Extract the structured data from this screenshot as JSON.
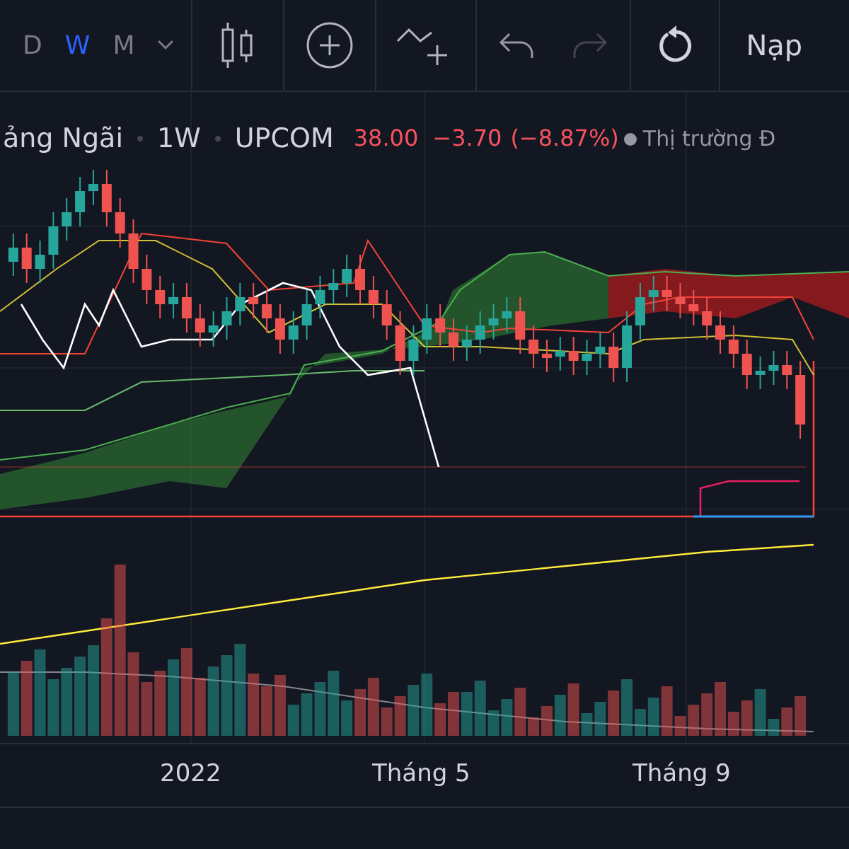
{
  "toolbar": {
    "intervals": [
      {
        "label": "D",
        "selected": false
      },
      {
        "label": "W",
        "selected": true
      },
      {
        "label": "M",
        "selected": false
      }
    ],
    "undo": {
      "disabled": false
    },
    "redo": {
      "disabled": true
    },
    "load_button": "Nạp"
  },
  "legend": {
    "symbol": "ảng Ngãi",
    "interval": "1W",
    "exchange": "UPCOM",
    "price": "38.00",
    "change": "−3.70",
    "change_pct": "(−8.87%)",
    "market_status": "Thị trường Đ"
  },
  "x_axis": {
    "labels": [
      "2022",
      "Tháng 5",
      "Tháng 9"
    ]
  }
}
